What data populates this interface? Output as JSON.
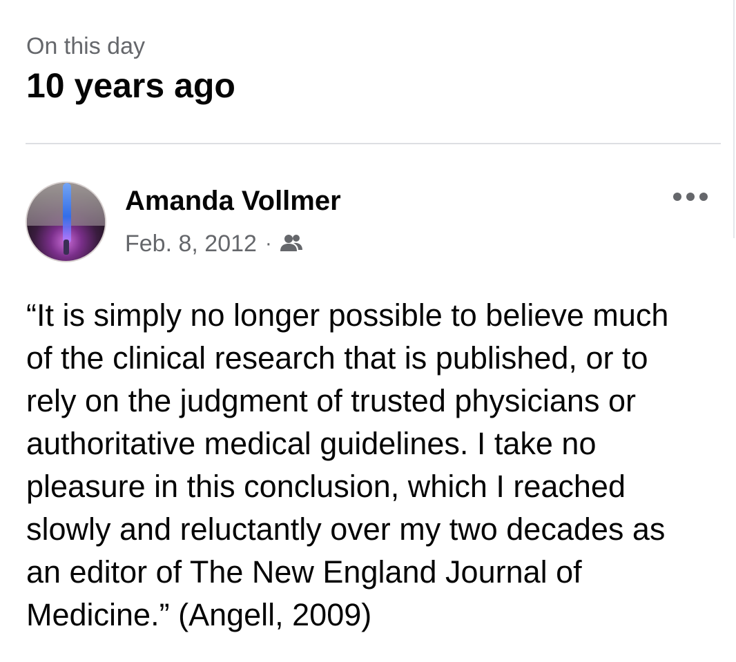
{
  "header": {
    "kicker": "On this day",
    "title": "10 years ago"
  },
  "post": {
    "author": "Amanda Vollmer",
    "date": "Feb. 8, 2012",
    "separator": "·",
    "audience_icon": "friends-icon",
    "more_icon": "more-options-icon",
    "text": "“It is simply no longer possible to believe much\nof the clinical research that is published, or to\nrely on the judgment of trusted physicians or\nauthoritative medical guidelines. I take no\npleasure in this conclusion, which I reached\nslowly and reluctantly over my two decades as\nan editor of The New England Journal of\nMedicine.” (Angell, 2009)"
  },
  "colors": {
    "primary_text": "#050505",
    "secondary_text": "#65676b",
    "divider": "#dddfe2"
  }
}
